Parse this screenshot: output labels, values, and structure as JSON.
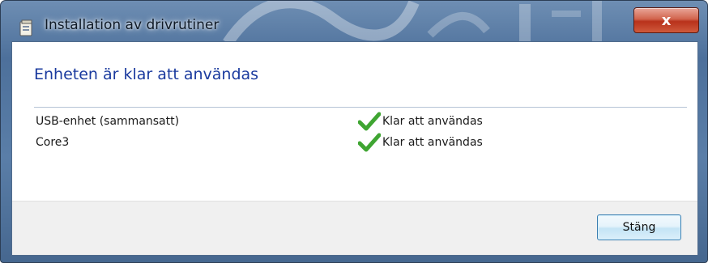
{
  "window": {
    "title": "Installation av drivrutiner",
    "close_glyph": "x"
  },
  "content": {
    "heading": "Enheten är klar att användas",
    "devices": [
      {
        "name": "USB-enhet (sammansatt)",
        "status": "Klar att användas",
        "status_icon": "green-check-icon"
      },
      {
        "name": "Core3",
        "status": "Klar att användas",
        "status_icon": "green-check-icon"
      }
    ]
  },
  "footer": {
    "close_button_label": "Stäng"
  },
  "colors": {
    "heading": "#1a3a9e",
    "check": "#3fa532",
    "title_bar": "#5a7ea8",
    "close_button": "#c9432a",
    "footer_bg": "#f0f0f0"
  }
}
